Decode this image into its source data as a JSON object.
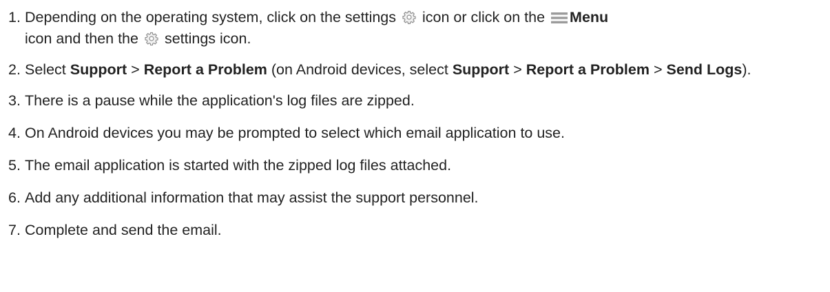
{
  "steps": [
    {
      "number": "1.",
      "t1": "Depending on the operating system, click on the settings",
      "t2": "icon or click on the",
      "t3": "Menu",
      "t4": "icon and then the",
      "t5": "settings icon."
    },
    {
      "number": "2.",
      "t1": "Select",
      "t2": "Support",
      "t3": ">",
      "t4": "Report a Problem",
      "t5": "(on Android devices, select",
      "t6": "Support",
      "t7": ">",
      "t8": "Report a Problem",
      "t9": ">",
      "t10": "Send Logs",
      "t11": ")."
    },
    {
      "number": "3.",
      "text": "There is a pause while the application's log files are zipped."
    },
    {
      "number": "4.",
      "text": "On Android devices you may be prompted to select which email application to use."
    },
    {
      "number": "5.",
      "text": "The email application is started with the zipped log files attached."
    },
    {
      "number": "6.",
      "text": "Add any additional information that may assist the support personnel."
    },
    {
      "number": "7.",
      "text": "Complete and send the email."
    }
  ],
  "icons": {
    "settings": "gear-icon",
    "menu": "hamburger-menu-icon"
  }
}
